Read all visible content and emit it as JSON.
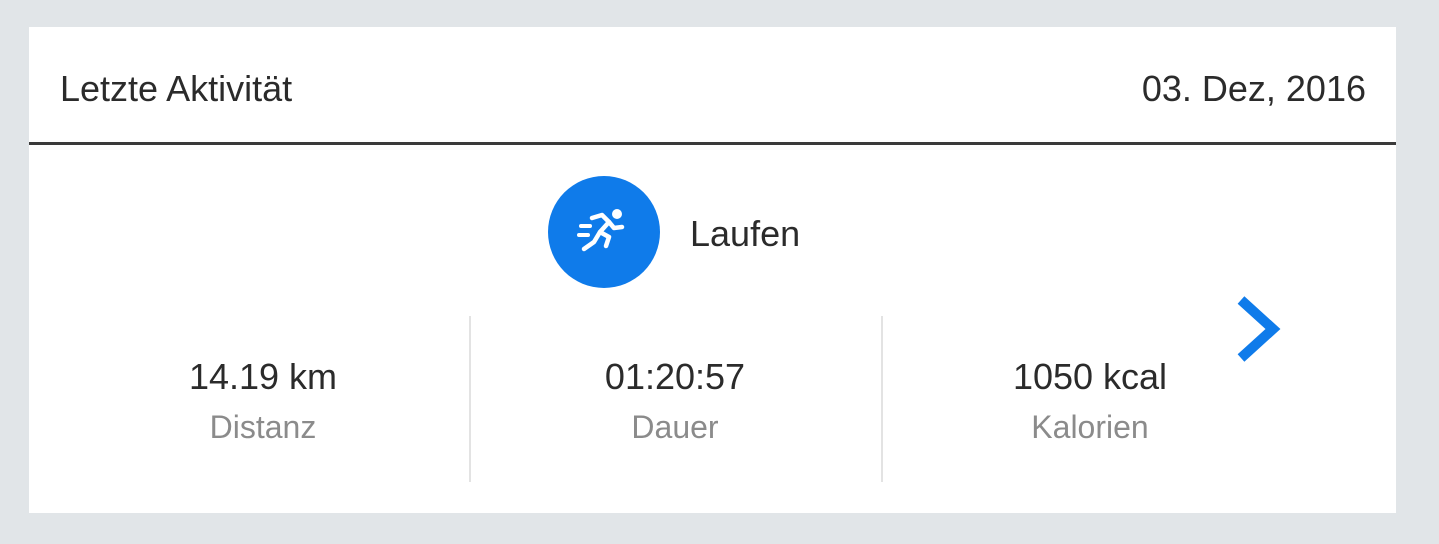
{
  "header": {
    "title": "Letzte Aktivität",
    "date": "03. Dez, 2016"
  },
  "activity": {
    "icon": "running-icon",
    "label": "Laufen",
    "accent_color": "#0f7bea"
  },
  "stats": [
    {
      "value": "14.19 km",
      "label": "Distanz"
    },
    {
      "value": "01:20:57",
      "label": "Dauer"
    },
    {
      "value": "1050 kcal",
      "label": "Kalorien"
    }
  ],
  "navigation": {
    "icon": "chevron-right-icon"
  }
}
